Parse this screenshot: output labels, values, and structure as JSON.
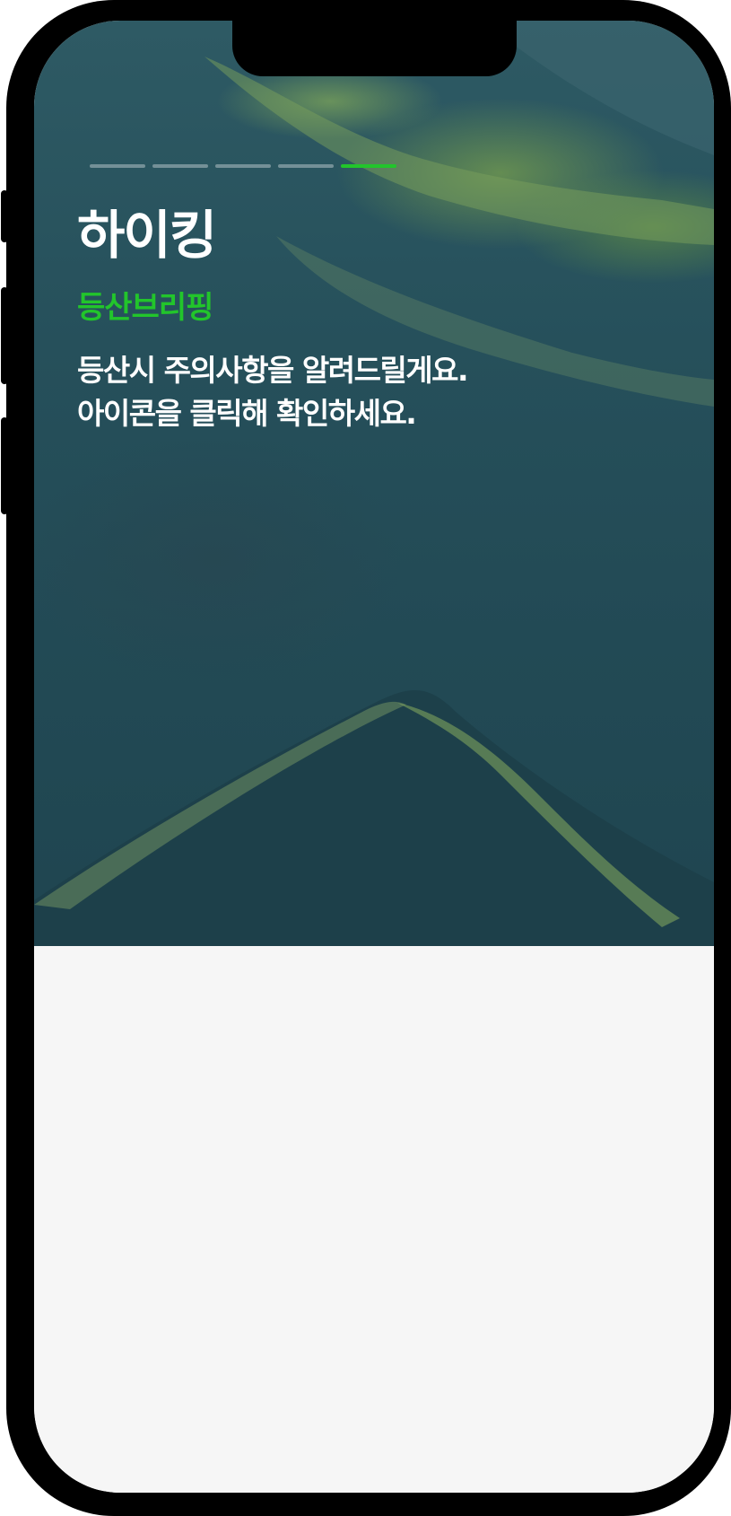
{
  "onboarding": {
    "title": "하이킹",
    "subtitle": "등산브리핑",
    "description_lines": [
      "등산시 주의사항을 알려드릴게요.",
      "아이콘을 클릭해 확인하세요."
    ],
    "progress": {
      "total": 5,
      "current": 5
    }
  },
  "colors": {
    "accent": "#22c52b",
    "text": "#ffffff",
    "bottom_panel": "#f6f6f6",
    "device_frame": "#000000"
  }
}
